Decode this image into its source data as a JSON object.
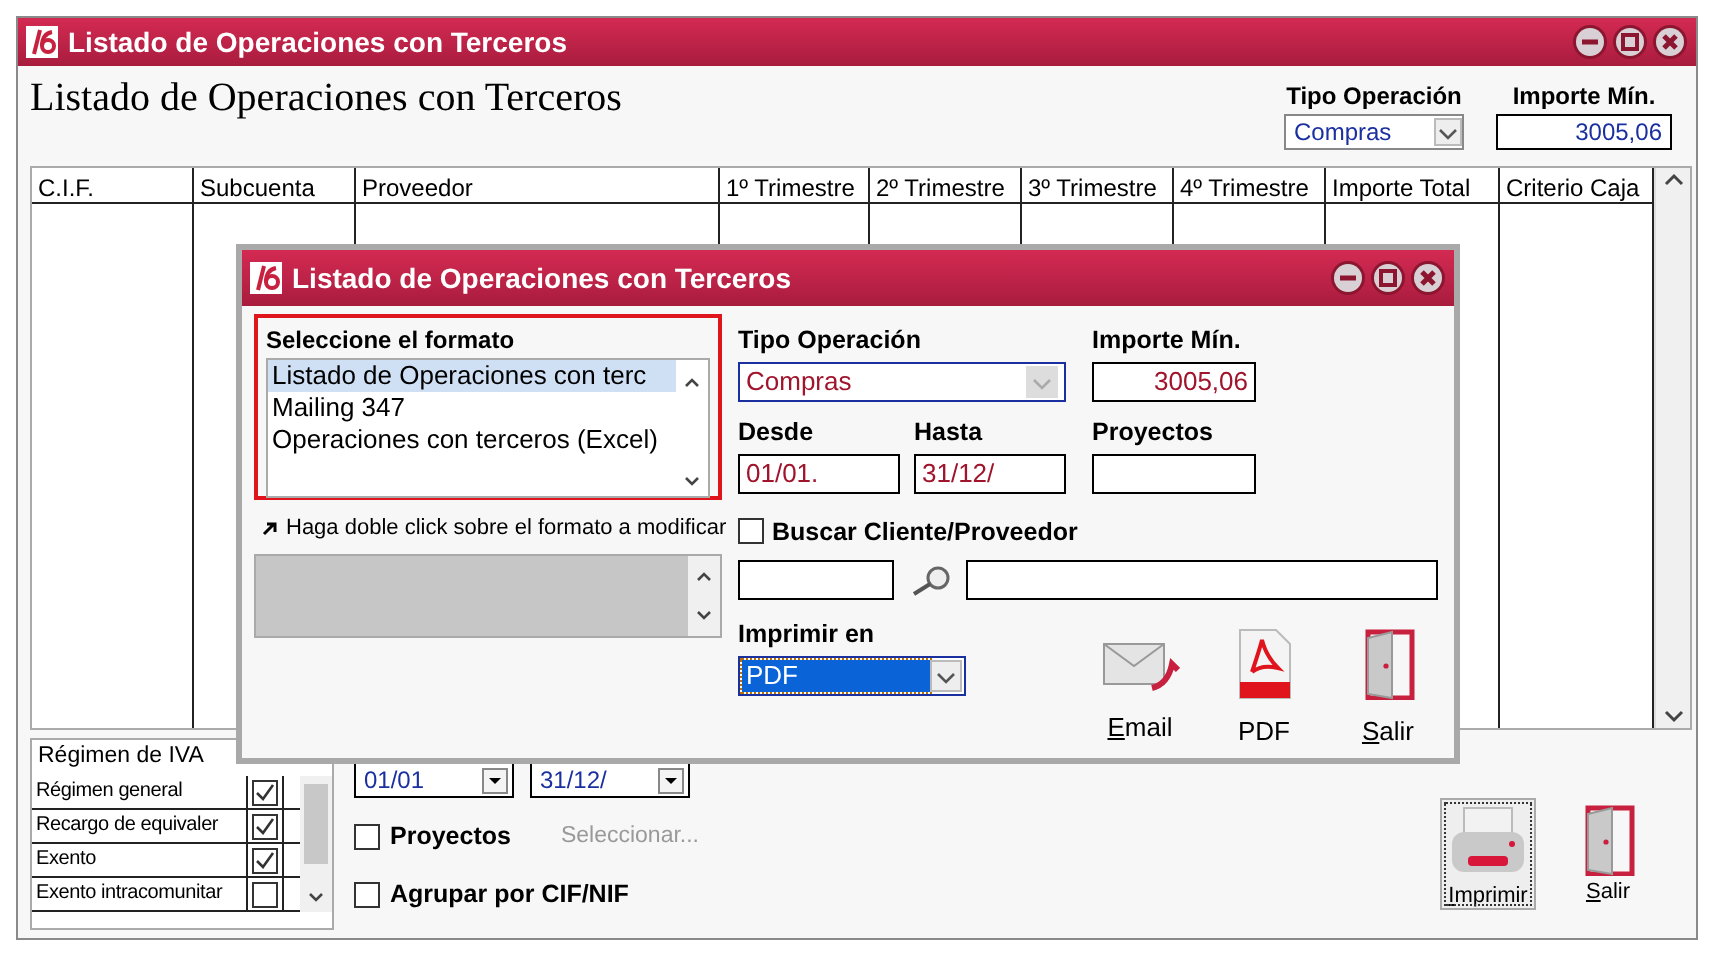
{
  "main_window": {
    "title": "Listado de Operaciones con Terceros",
    "heading": "Listado de Operaciones con Terceros",
    "filters": [
      {
        "kind": "select",
        "label": "Tipo Operación",
        "value": "Compras"
      },
      {
        "kind": "input",
        "label": "Importe Mín.",
        "value": "3005,06"
      }
    ],
    "table": {
      "columns": [
        "C.I.F.",
        "Subcuenta",
        "Proveedor",
        "1º Trimestre",
        "2º Trimestre",
        "3º Trimestre",
        "4º Trimestre",
        "Importe Total",
        "Criterio Caja"
      ]
    },
    "iva_list": {
      "header": "Régimen de IVA",
      "items": [
        {
          "label": "Régimen general",
          "checked": true
        },
        {
          "label": "Recargo de equivaler",
          "checked": true
        },
        {
          "label": "Exento",
          "checked": true
        },
        {
          "label": "Exento intracomunitar",
          "checked": false
        }
      ]
    },
    "date_from": "01/01",
    "date_to": "31/12/",
    "options": [
      {
        "label": "Proyectos",
        "checked": false,
        "link": "Seleccionar..."
      },
      {
        "label": "Agrupar por CIF/NIF",
        "checked": false
      }
    ],
    "buttons": [
      {
        "kind": "print",
        "label": "Imprimir",
        "focused": true
      },
      {
        "kind": "exit",
        "label": "Salir",
        "focused": false
      }
    ]
  },
  "dialog": {
    "title": "Listado de Operaciones con Terceros",
    "format_list": {
      "label": "Seleccione el formato",
      "items": [
        {
          "text": "Listado de Operaciones con terc",
          "selected": true
        },
        {
          "text": "Mailing 347",
          "selected": false
        },
        {
          "text": "Operaciones con terceros (Excel)",
          "selected": false
        }
      ]
    },
    "hint": "Haga doble click sobre el formato a modificar",
    "tipo_operacion": {
      "label": "Tipo Operación",
      "value": "Compras"
    },
    "importe_min": {
      "label": "Importe Mín.",
      "value": "3005,06"
    },
    "desde": {
      "label": "Desde",
      "value": "01/01."
    },
    "hasta": {
      "label": "Hasta",
      "value": "31/12/"
    },
    "proyectos": {
      "label": "Proyectos"
    },
    "buscar": {
      "label": "Buscar Cliente/Proveedor",
      "checked": false
    },
    "imprimir_en": {
      "label": "Imprimir en",
      "value": "PDF"
    },
    "actions": [
      {
        "kind": "email",
        "label": "Email"
      },
      {
        "kind": "pdf",
        "label": "PDF"
      },
      {
        "kind": "exit",
        "label": "Salir"
      }
    ]
  }
}
